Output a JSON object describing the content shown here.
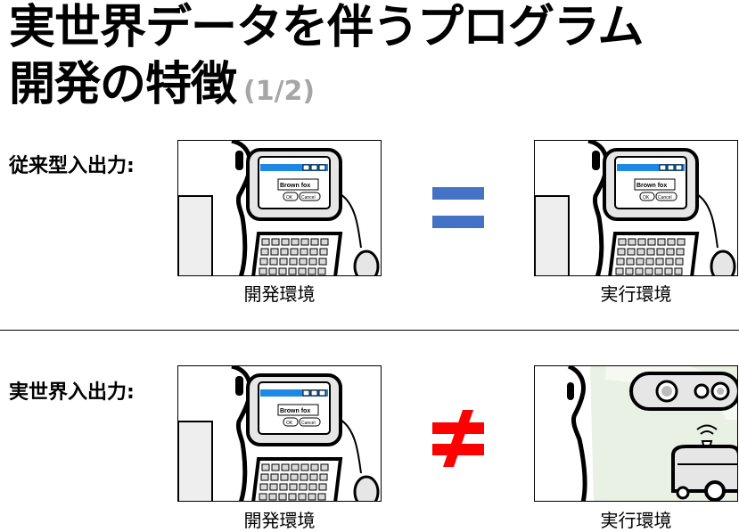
{
  "title": {
    "line1": "実世界データを伴うプログラム",
    "line2": "開発の特徴",
    "page_indicator": "(1/2)"
  },
  "rows": [
    {
      "label": "従来型入出力:",
      "left_caption": "開発環境",
      "right_caption": "実行環境",
      "relation": "equals"
    },
    {
      "label": "実世界入出力:",
      "left_caption": "開発環境",
      "right_caption": "実行環境",
      "relation": "not-equals"
    }
  ],
  "dialog": {
    "text": "Brown fox",
    "ok_label": "OK",
    "cancel_label": "Cancel"
  },
  "colors": {
    "equals_sign": "#4472c4",
    "not_equals_sign": "#ff0000",
    "page_indicator": "#a6a6a6",
    "dialog_titlebar": "#1e88e5",
    "env_background": "#e8f1e4"
  }
}
